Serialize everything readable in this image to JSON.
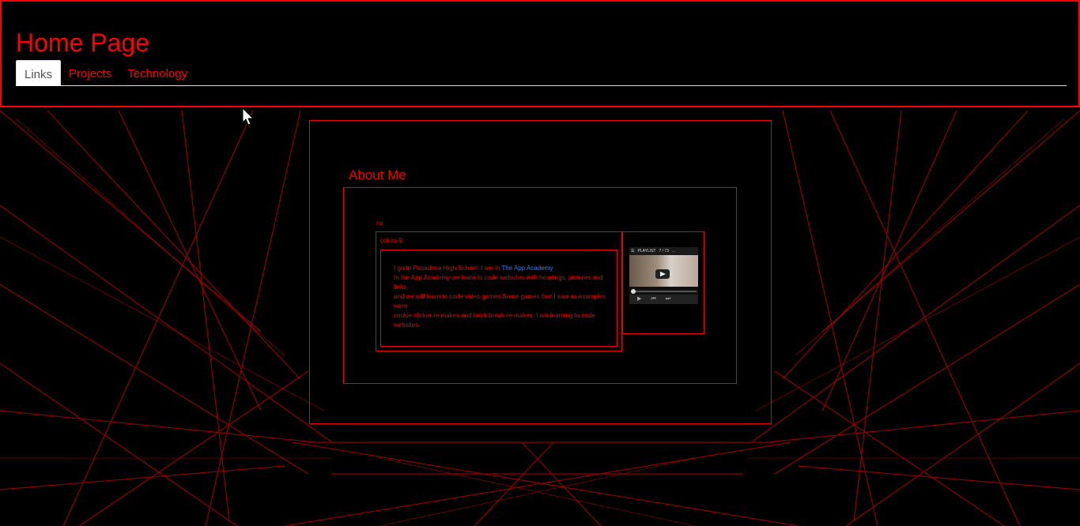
{
  "header": {
    "title": "Home Page",
    "tabs": [
      {
        "label": "Links",
        "active": true
      },
      {
        "label": "Projects",
        "active": false
      },
      {
        "label": "Technology",
        "active": false
      }
    ]
  },
  "main": {
    "section_title": "About Me",
    "row_label": "rw",
    "col_label": "col-xs-9",
    "bio": {
      "line1_pre": "I go to Pasadena High School. I am in ",
      "link": "The App Academy",
      "line1_post": ".",
      "line2": "In the App Academy we learn to code websites with headings, pictures and links,",
      "line3": "and we will learn to code video games.Some games that I saw as examples were",
      "line4": "cookie clicker re makes and brick break re-makes. I am learning to code websites."
    },
    "video": {
      "playlist_label": "PLAYLIST",
      "count": "7 / 73",
      "more": "..."
    }
  },
  "colors": {
    "accent": "#ff0000",
    "link": "#3a7be0",
    "background": "#000000"
  }
}
